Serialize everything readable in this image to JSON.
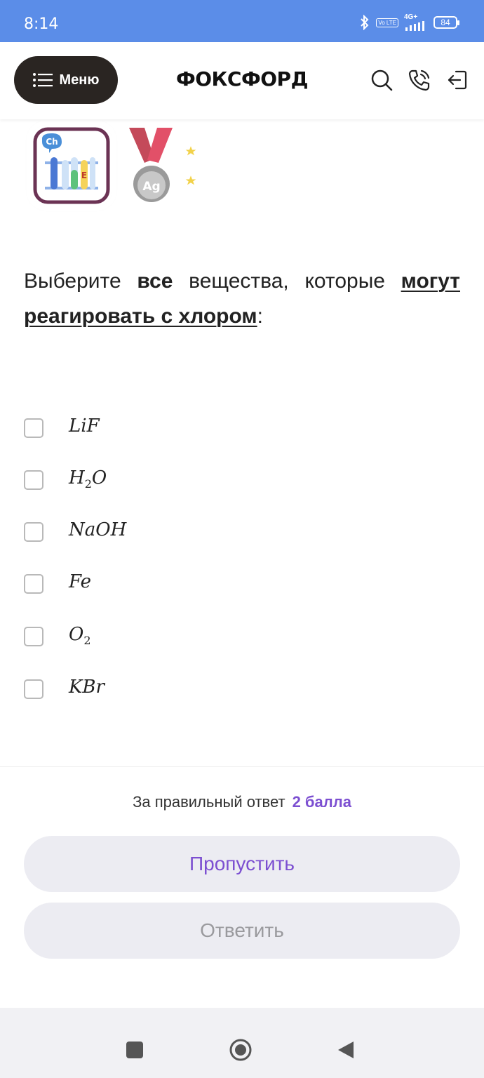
{
  "status_bar": {
    "time": "8:14",
    "volte": "Vo LTE",
    "network": "4G+",
    "battery": "84"
  },
  "header": {
    "menu_label": "Меню",
    "logo": "ФОКСФОРД"
  },
  "badges": {
    "chem_letters": "Ch",
    "tube_letter": "E",
    "medal_text": "Ag"
  },
  "question": {
    "part1": "Выберите ",
    "bold1": "все",
    "part2": " вещества, которые ",
    "bold2": "могут реагировать с хлором",
    "part3": ":"
  },
  "options": [
    {
      "base": "LiF",
      "sub": "",
      "tail": ""
    },
    {
      "base": "H",
      "sub": "2",
      "tail": "O"
    },
    {
      "base": "NaOH",
      "sub": "",
      "tail": ""
    },
    {
      "base": "Fe",
      "sub": "",
      "tail": ""
    },
    {
      "base": "O",
      "sub": "2",
      "tail": ""
    },
    {
      "base": "KBr",
      "sub": "",
      "tail": ""
    }
  ],
  "points": {
    "label": "За правильный ответ",
    "value": "2 балла"
  },
  "buttons": {
    "skip": "Пропустить",
    "answer": "Ответить"
  },
  "colors": {
    "accent": "#7c4fd1",
    "status_bar": "#5b8de8",
    "menu_bg": "#2a2522"
  }
}
